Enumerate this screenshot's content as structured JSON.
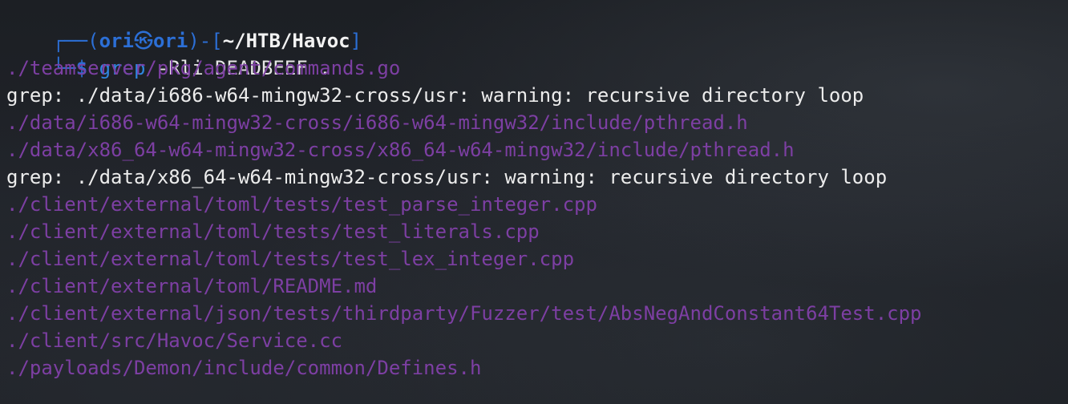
{
  "prompt": {
    "box_top_left": "┌──",
    "open_paren": "(",
    "user": "ori",
    "skull": "㉿",
    "host": "ori",
    "close_paren": ")-[",
    "cwd": "~/HTB/Havoc",
    "close_bracket": "]",
    "box_bottom_left": "└─",
    "dollar": "$",
    "command": "grep",
    "args": "-Rli DEADBEEF ."
  },
  "output": [
    {
      "type": "file",
      "text": "./teamserver/pkg/agent/commands.go"
    },
    {
      "type": "warning",
      "text": "grep: ./data/i686-w64-mingw32-cross/usr: warning: recursive directory loop"
    },
    {
      "type": "file",
      "text": "./data/i686-w64-mingw32-cross/i686-w64-mingw32/include/pthread.h"
    },
    {
      "type": "file",
      "text": "./data/x86_64-w64-mingw32-cross/x86_64-w64-mingw32/include/pthread.h"
    },
    {
      "type": "warning",
      "text": "grep: ./data/x86_64-w64-mingw32-cross/usr: warning: recursive directory loop"
    },
    {
      "type": "file",
      "text": "./client/external/toml/tests/test_parse_integer.cpp"
    },
    {
      "type": "file",
      "text": "./client/external/toml/tests/test_literals.cpp"
    },
    {
      "type": "file",
      "text": "./client/external/toml/tests/test_lex_integer.cpp"
    },
    {
      "type": "file",
      "text": "./client/external/toml/README.md"
    },
    {
      "type": "file",
      "text": "./client/external/json/tests/thirdparty/Fuzzer/test/AbsNegAndConstant64Test.cpp"
    },
    {
      "type": "file",
      "text": "./client/src/Havoc/Service.cc"
    },
    {
      "type": "file",
      "text": "./payloads/Demon/include/common/Defines.h"
    }
  ],
  "colors": {
    "prompt_blue": "#2c6fd6",
    "command_blue": "#2f86e0",
    "file_purple": "#7d3fa3",
    "text": "#e6e6e6",
    "background": "#1e2126"
  }
}
